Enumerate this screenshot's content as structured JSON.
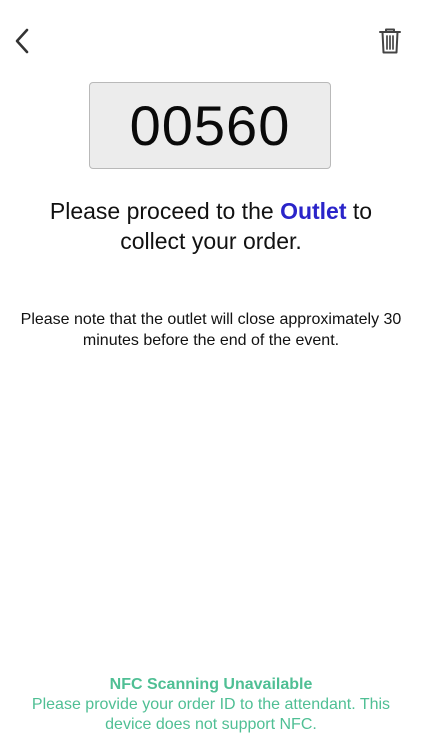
{
  "header": {
    "back_icon": "chevron-left-icon",
    "delete_icon": "trash-icon"
  },
  "order": {
    "number": "00560"
  },
  "instructions": {
    "proceed_prefix": "Please proceed to the ",
    "outlet_name": "Outlet",
    "proceed_suffix": " to collect your order.",
    "outlet_color": "#2a24c9"
  },
  "note": {
    "text": "Please note that the outlet will close approximately 30 minutes before the end of the event."
  },
  "nfc": {
    "title": "NFC Scanning Unavailable",
    "message": "Please provide your order ID to the attendant. This device does not support NFC.",
    "color": "#4fbf94"
  }
}
